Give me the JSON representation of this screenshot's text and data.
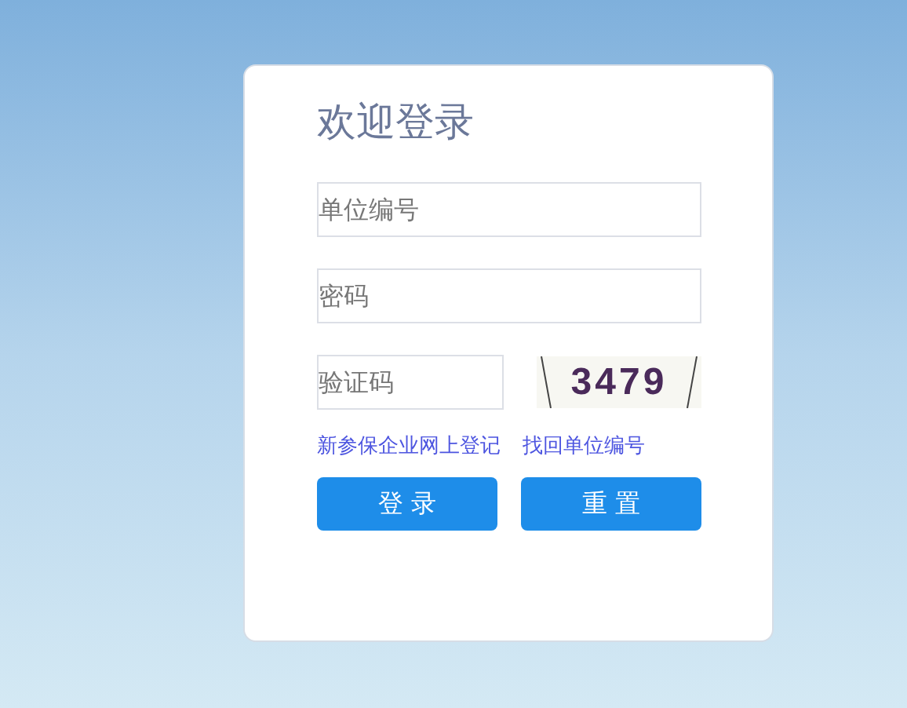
{
  "title": "欢迎登录",
  "fields": [
    {
      "placeholder": "单位编号"
    },
    {
      "placeholder": "密码"
    }
  ],
  "captcha": {
    "placeholder": "验证码",
    "image_text": "3479"
  },
  "links": [
    "新参保企业网上登记",
    "找回单位编号"
  ],
  "buttons": [
    "登 录",
    "重 置"
  ]
}
